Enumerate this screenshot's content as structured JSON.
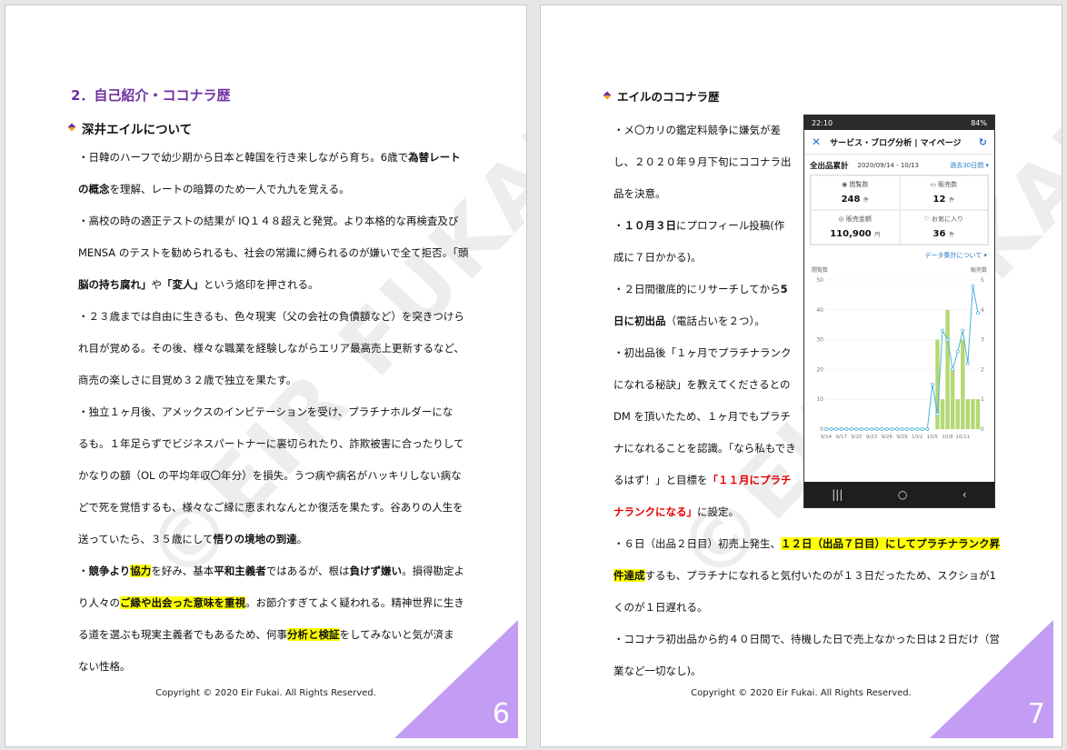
{
  "page6": {
    "heading": "2．自己紹介・ココナラ歴",
    "subheading": "深井エイルについて",
    "watermark": "©EIR FUKAI",
    "lines": [
      [
        {
          "t": "・日韓のハーフで幼少期から日本と韓国を行き来しながら育ち。6歳で"
        },
        {
          "t": "為替レート",
          "s": "b"
        }
      ],
      [
        {
          "t": "の概念",
          "s": "b"
        },
        {
          "t": "を理解、レートの暗算のため一人で九九を覚える。"
        }
      ],
      [
        {
          "t": "・高校の時の適正テストの結果が IQ１４８超えと発覚。より本格的な再検査及び"
        }
      ],
      [
        {
          "t": "MENSA のテストを勧められるも、社会の常識に縛られるのが嫌いで全て拒否。「頭"
        }
      ],
      [
        {
          "t": "脳の持ち腐れ」",
          "s": "b"
        },
        {
          "t": "や"
        },
        {
          "t": "「変人」",
          "s": "b"
        },
        {
          "t": "という烙印を押される。"
        }
      ],
      [
        {
          "t": "・２３歳までは自由に生きるも、色々現実（父の会社の負債額など）を突きつけら"
        }
      ],
      [
        {
          "t": "れ目が覚める。その後、様々な職業を経験しながらエリア最高売上更新するなど、"
        }
      ],
      [
        {
          "t": "商売の楽しさに目覚め３２歳で独立を果たす。"
        }
      ],
      [
        {
          "t": "・独立１ヶ月後、アメックスのインビテーションを受け、プラチナホルダーにな"
        }
      ],
      [
        {
          "t": "るも。１年足らずでビジネスパートナーに裏切られたり、詐欺被害に合ったりして"
        }
      ],
      [
        {
          "t": "かなりの額（OL の平均年収〇年分）を損失。うつ病や病名がハッキリしない病な"
        }
      ],
      [
        {
          "t": "どで死を覚悟するも、様々なご縁に恵まれなんとか復活を果たす。谷ありの人生を"
        }
      ],
      [
        {
          "t": "送っていたら、３５歳にして"
        },
        {
          "t": "悟りの境地の到達",
          "s": "b"
        },
        {
          "t": "。"
        }
      ],
      [
        {
          "t": "・"
        },
        {
          "t": "競争より",
          "s": "b"
        },
        {
          "t": "協力",
          "s": "hl"
        },
        {
          "t": "を好み、基本"
        },
        {
          "t": "平和主義者",
          "s": "b"
        },
        {
          "t": "ではあるが、根は"
        },
        {
          "t": "負けず嫌い",
          "s": "b"
        },
        {
          "t": "。損得勘定よ"
        }
      ],
      [
        {
          "t": "り人々の"
        },
        {
          "t": "ご縁や出会った意味を重視",
          "s": "hl"
        },
        {
          "t": "。お節介すぎてよく疑われる。精神世界に生き"
        }
      ],
      [
        {
          "t": "る道を選ぶも現実主義者でもあるため、何事"
        },
        {
          "t": "分析と検証",
          "s": "hl"
        },
        {
          "t": "をしてみないと気が済ま"
        }
      ],
      [
        {
          "t": "ない性格。"
        }
      ]
    ],
    "footer": "Copyright © 2020 Eir Fukai. All Rights Reserved.",
    "page_number": "6"
  },
  "page7": {
    "subheading": "エイルのココナラ歴",
    "watermark": "©EIR FUKAI",
    "narrow_lines": [
      [
        {
          "t": "・メ〇カリの鑑定料競争に嫌気が差"
        }
      ],
      [
        {
          "t": "し、２０２０年９月下旬にココナラ出"
        }
      ],
      [
        {
          "t": "品を決意。"
        }
      ],
      [
        {
          "t": "・"
        },
        {
          "t": "１０月３日",
          "s": "b"
        },
        {
          "t": "にプロフィール投稿(作"
        }
      ],
      [
        {
          "t": "成に７日かかる)。"
        }
      ],
      [
        {
          "t": "・２日間徹底的にリサーチしてから"
        },
        {
          "t": "5",
          "s": "b"
        }
      ],
      [
        {
          "t": "日に初出品",
          "s": "b"
        },
        {
          "t": "（電話占いを２つ）。"
        }
      ],
      [
        {
          "t": "・初出品後「１ヶ月でプラチナランク"
        }
      ],
      [
        {
          "t": "になれる秘訣」を教えてくださるとの"
        }
      ],
      [
        {
          "t": "DM を頂いたため、１ヶ月でもプラチ"
        }
      ],
      [
        {
          "t": "ナになれることを認識。「なら私もでき"
        }
      ],
      [
        {
          "t": "るはず！」と目標を"
        },
        {
          "t": "「１１月にプラチ",
          "s": "r"
        }
      ],
      [
        {
          "t": "ナランクになる」",
          "s": "r"
        },
        {
          "t": "に設定。"
        }
      ]
    ],
    "wide_lines": [
      [
        {
          "t": "・６日（出品２日目）初売上発生、"
        },
        {
          "t": "１２日（出品７日目）にしてプラチナランク昇",
          "s": "hl"
        }
      ],
      [
        {
          "t": "件達成",
          "s": "hl"
        },
        {
          "t": "するも、プラチナになれると気付いたのが１３日だったため、スクショが1"
        }
      ],
      [
        {
          "t": "くのが１日遅れる。"
        }
      ],
      [
        {
          "t": "・ココナラ初出品から約４０日間で、待機した日で売上なかった日は２日だけ（営"
        }
      ],
      [
        {
          "t": "業など一切なし)。"
        }
      ]
    ],
    "footer": "Copyright © 2020 Eir Fukai. All Rights Reserved.",
    "page_number": "7",
    "phone": {
      "status_time": "22:10",
      "status_right": "84%",
      "title": "サービス・ブログ分析 | マイページ",
      "summary_label": "全出品累計",
      "date_range": "2020/09/14 - 10/13",
      "period_link": "過去30日間",
      "stats": [
        {
          "label": "閲覧数",
          "value": "248",
          "unit": "件"
        },
        {
          "label": "販売数",
          "value": "12",
          "unit": "件"
        },
        {
          "label": "販売金額",
          "value": "110,900",
          "unit": "円"
        },
        {
          "label": "お気に入り",
          "value": "36",
          "unit": "件"
        }
      ],
      "note": "データ集計について",
      "left_axis_title": "閲覧数",
      "right_axis_title": "販売数"
    }
  },
  "chart_data": {
    "type": "bar",
    "left_axis": {
      "label": "閲覧数",
      "ylim": [
        0,
        50
      ],
      "ticks": [
        0,
        10,
        20,
        30,
        40,
        50
      ]
    },
    "right_axis": {
      "label": "販売数",
      "ylim": [
        0,
        5
      ],
      "ticks": [
        0,
        1,
        2,
        3,
        4,
        5
      ]
    },
    "x_tick_labels": [
      "9/14",
      "9/17",
      "9/20",
      "9/23",
      "9/26",
      "9/29",
      "10/2",
      "10/5",
      "10/8",
      "10/11"
    ],
    "series": [
      {
        "kind": "line",
        "axis": "left",
        "values": [
          0,
          0,
          0,
          0,
          0,
          0,
          0,
          0,
          0,
          0,
          0,
          0,
          0,
          0,
          0,
          0,
          0,
          0,
          0,
          0,
          0,
          15,
          5,
          33,
          30,
          20,
          26,
          33,
          22,
          48,
          39
        ]
      },
      {
        "kind": "bar",
        "axis": "right",
        "values": [
          0,
          0,
          0,
          0,
          0,
          0,
          0,
          0,
          0,
          0,
          0,
          0,
          0,
          0,
          0,
          0,
          0,
          0,
          0,
          0,
          0,
          0,
          3,
          1,
          4,
          2,
          1,
          3,
          1,
          1,
          1
        ]
      }
    ],
    "colors": {
      "line": "#4ab0d8",
      "bar": "#b5d873"
    }
  }
}
